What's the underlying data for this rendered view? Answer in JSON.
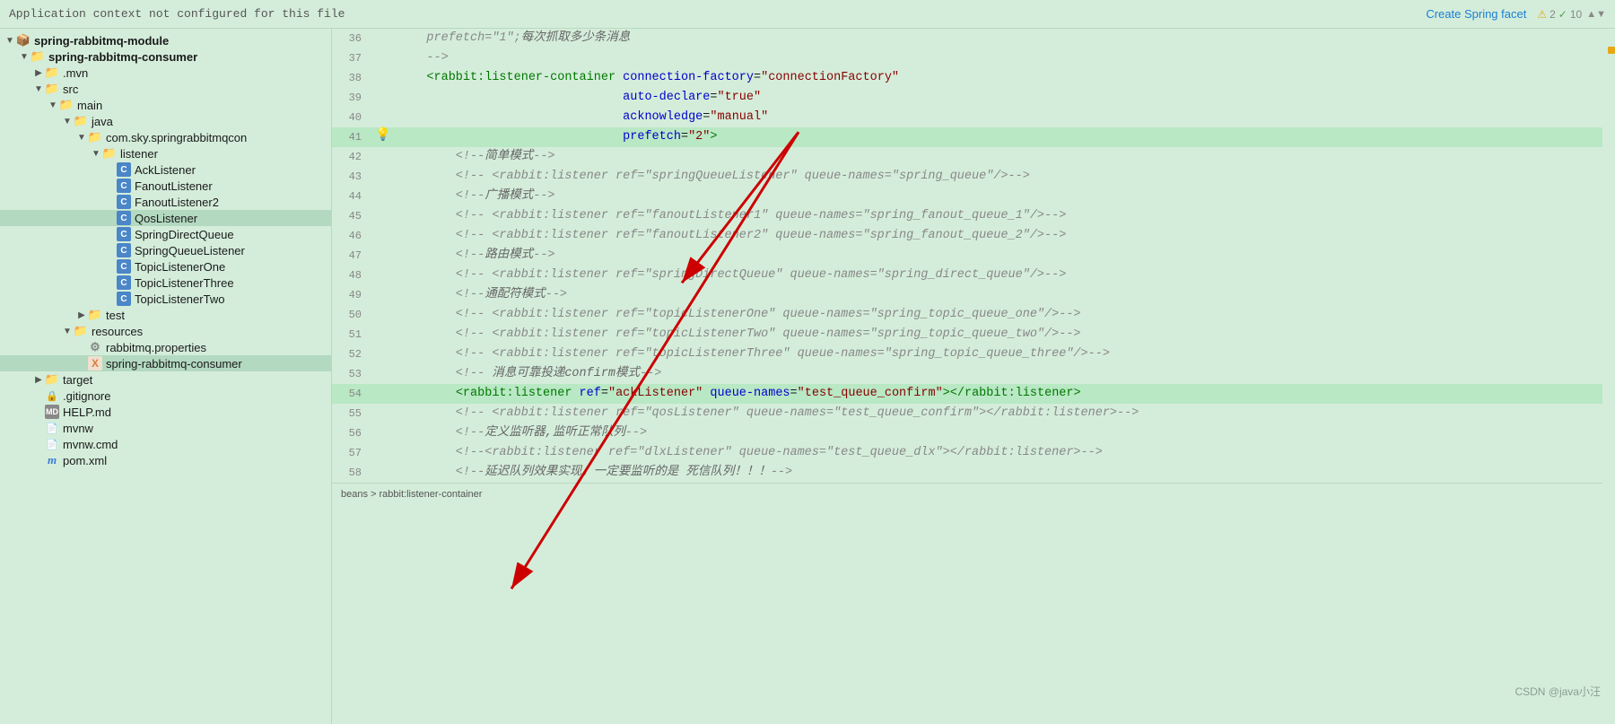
{
  "topBar": {
    "message": "Application context not configured for this file",
    "createSpringFacet": "Create Spring facet",
    "warningCount": "2",
    "checkCount": "10"
  },
  "sidebar": {
    "rootModule": "spring-rabbitmq-module",
    "items": [
      {
        "id": "spring-rabbitmq-consumer",
        "label": "spring-rabbitmq-consumer",
        "indent": 1,
        "type": "module",
        "expanded": true
      },
      {
        "id": "mvn",
        "label": ".mvn",
        "indent": 2,
        "type": "folder-closed",
        "expanded": false
      },
      {
        "id": "src",
        "label": "src",
        "indent": 2,
        "type": "folder",
        "expanded": true
      },
      {
        "id": "main",
        "label": "main",
        "indent": 3,
        "type": "folder",
        "expanded": true
      },
      {
        "id": "java",
        "label": "java",
        "indent": 4,
        "type": "folder",
        "expanded": true
      },
      {
        "id": "com-sky",
        "label": "com.sky.springrabbitmqcon",
        "indent": 5,
        "type": "folder",
        "expanded": true
      },
      {
        "id": "listener",
        "label": "listener",
        "indent": 6,
        "type": "folder",
        "expanded": true
      },
      {
        "id": "AckListener",
        "label": "AckListener",
        "indent": 7,
        "type": "class"
      },
      {
        "id": "FanoutListener",
        "label": "FanoutListener",
        "indent": 7,
        "type": "class"
      },
      {
        "id": "FanoutListener2",
        "label": "FanoutListener2",
        "indent": 7,
        "type": "class"
      },
      {
        "id": "QosListener",
        "label": "QosListener",
        "indent": 7,
        "type": "class",
        "selected": true
      },
      {
        "id": "SpringDirectQueue",
        "label": "SpringDirectQueue",
        "indent": 7,
        "type": "class"
      },
      {
        "id": "SpringQueueListener",
        "label": "SpringQueueListener",
        "indent": 7,
        "type": "class"
      },
      {
        "id": "TopicListenerOne",
        "label": "TopicListenerOne",
        "indent": 7,
        "type": "class"
      },
      {
        "id": "TopicListenerThree",
        "label": "TopicListenerThree",
        "indent": 7,
        "type": "class"
      },
      {
        "id": "TopicListenerTwo",
        "label": "TopicListenerTwo",
        "indent": 7,
        "type": "class"
      },
      {
        "id": "test",
        "label": "test",
        "indent": 5,
        "type": "folder-closed"
      },
      {
        "id": "resources",
        "label": "resources",
        "indent": 4,
        "type": "folder",
        "expanded": true
      },
      {
        "id": "rabbitmq-props",
        "label": "rabbitmq.properties",
        "indent": 5,
        "type": "properties"
      },
      {
        "id": "spring-rabbitmq-consumer-xml",
        "label": "spring-rabbitmq-consumer",
        "indent": 5,
        "type": "xml",
        "selected": true
      },
      {
        "id": "target",
        "label": "target",
        "indent": 2,
        "type": "folder-closed"
      },
      {
        "id": "gitignore",
        "label": ".gitignore",
        "indent": 2,
        "type": "gitignore"
      },
      {
        "id": "HELP-md",
        "label": "HELP.md",
        "indent": 2,
        "type": "md"
      },
      {
        "id": "mvnw",
        "label": "mvnw",
        "indent": 2,
        "type": "mvnw"
      },
      {
        "id": "mvnw-cmd",
        "label": "mvnw.cmd",
        "indent": 2,
        "type": "mvnw"
      },
      {
        "id": "pom-xml",
        "label": "pom.xml",
        "indent": 2,
        "type": "pom"
      }
    ]
  },
  "editor": {
    "lines": [
      {
        "num": 36,
        "content": "    prefetch=\"1\";每次抓取多少条消息",
        "type": "comment"
      },
      {
        "num": 37,
        "content": "    -->",
        "type": "comment"
      },
      {
        "num": 38,
        "content": "    <rabbit:listener-container connection-factory=\"connectionFactory\"",
        "type": "tag"
      },
      {
        "num": 39,
        "content": "                               auto-declare=\"true\"",
        "type": "attr"
      },
      {
        "num": 40,
        "content": "                               acknowledge=\"manual\"",
        "type": "attr"
      },
      {
        "num": 41,
        "content": "                               prefetch=\"2\">",
        "type": "tag",
        "highlighted": true,
        "hasBulb": true,
        "hasCursor": true
      },
      {
        "num": 42,
        "content": "        <!--简单模式-->",
        "type": "comment"
      },
      {
        "num": 43,
        "content": "        <!-- <rabbit:listener ref=\"springQueueListener\" queue-names=\"spring_queue\"/>-->",
        "type": "comment"
      },
      {
        "num": 44,
        "content": "        <!--广播模式-->",
        "type": "comment"
      },
      {
        "num": 45,
        "content": "        <!-- <rabbit:listener ref=\"fanoutListener1\" queue-names=\"spring_fanout_queue_1\"/>-->",
        "type": "comment"
      },
      {
        "num": 46,
        "content": "        <!-- <rabbit:listener ref=\"fanoutListener2\" queue-names=\"spring_fanout_queue_2\"/>-->",
        "type": "comment"
      },
      {
        "num": 47,
        "content": "        <!--路由模式-->",
        "type": "comment"
      },
      {
        "num": 48,
        "content": "        <!-- <rabbit:listener ref=\"springDirectQueue\" queue-names=\"spring_direct_queue\"/>-->",
        "type": "comment"
      },
      {
        "num": 49,
        "content": "        <!--通配符模式-->",
        "type": "comment"
      },
      {
        "num": 50,
        "content": "        <!-- <rabbit:listener ref=\"topicListenerOne\" queue-names=\"spring_topic_queue_one\"/>-->",
        "type": "comment"
      },
      {
        "num": 51,
        "content": "        <!-- <rabbit:listener ref=\"topicListenerTwo\" queue-names=\"spring_topic_queue_two\"/>-->",
        "type": "comment"
      },
      {
        "num": 52,
        "content": "        <!-- <rabbit:listener ref=\"topicListenerThree\" queue-names=\"spring_topic_queue_three\"/>-->",
        "type": "comment"
      },
      {
        "num": 53,
        "content": "        <!-- 消息可靠投递confirm模式-->",
        "type": "comment"
      },
      {
        "num": 54,
        "content": "        <rabbit:listener ref=\"ackListener\" queue-names=\"test_queue_confirm\"></rabbit:listener>",
        "type": "tag",
        "highlighted": true
      },
      {
        "num": 55,
        "content": "        <!-- <rabbit:listener ref=\"qosListener\" queue-names=\"test_queue_confirm\"></rabbit:listener>-->",
        "type": "comment"
      },
      {
        "num": 56,
        "content": "        <!--定义监听器,监听正常队列-->",
        "type": "comment"
      },
      {
        "num": 57,
        "content": "        <!--<rabbit:listener ref=\"dlxListener\" queue-names=\"test_queue_dlx\"></rabbit:listener>-->",
        "type": "comment"
      },
      {
        "num": 58,
        "content": "        <!--延迟队列效果实现，一定要监听的是 死信队列！！！-->",
        "type": "comment"
      }
    ],
    "bottomBreadcrumb": "beans > rabbit:listener-container"
  },
  "watermark": "CSDN @java小汪"
}
